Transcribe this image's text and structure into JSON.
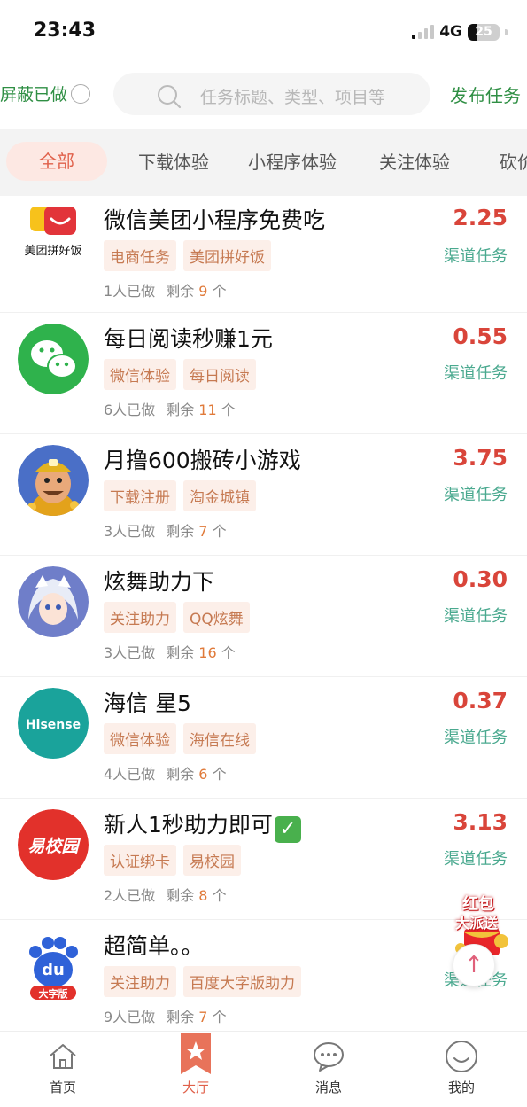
{
  "status_bar": {
    "time": "23:43",
    "network": "4G",
    "battery": "25",
    "battery_level": 0.25
  },
  "header": {
    "hide_done_label": "屏蔽已做",
    "search_placeholder": "任务标题、类型、项目等",
    "publish_label": "发布任务"
  },
  "tabs": [
    {
      "label": "全部",
      "active": true
    },
    {
      "label": "下载体验"
    },
    {
      "label": "小程序体验"
    },
    {
      "label": "关注体验"
    },
    {
      "label": "砍价"
    }
  ],
  "tasks": [
    {
      "title": "微信美团小程序免费吃",
      "tags": [
        "电商任务",
        "美团拼好饭"
      ],
      "done": "1人已做",
      "remain_label": "剩余",
      "remain_num": "9",
      "remain_unit": "个",
      "price": "2.25",
      "channel": "渠道任务",
      "logo_icon": "meituan-logo-icon",
      "logo_text": "美团拼好饭"
    },
    {
      "title": "每日阅读秒赚1元",
      "tags": [
        "微信体验",
        "每日阅读"
      ],
      "done": "6人已做",
      "remain_label": "剩余",
      "remain_num": "11",
      "remain_unit": "个",
      "price": "0.55",
      "channel": "渠道任务",
      "logo_icon": "wechat-logo-icon"
    },
    {
      "title": "月撸600搬砖小游戏",
      "tags": [
        "下载注册",
        "淘金城镇"
      ],
      "done": "3人已做",
      "remain_label": "剩余",
      "remain_num": "7",
      "remain_unit": "个",
      "price": "3.75",
      "channel": "渠道任务",
      "logo_icon": "miner-game-icon"
    },
    {
      "title": "炫舞助力下",
      "tags": [
        "关注助力",
        "QQ炫舞"
      ],
      "done": "3人已做",
      "remain_label": "剩余",
      "remain_num": "16",
      "remain_unit": "个",
      "price": "0.30",
      "channel": "渠道任务",
      "logo_icon": "qq-dance-icon"
    },
    {
      "title": "海信 星5",
      "tags": [
        "微信体验",
        "海信在线"
      ],
      "done": "4人已做",
      "remain_label": "剩余",
      "remain_num": "6",
      "remain_unit": "个",
      "price": "0.37",
      "channel": "渠道任务",
      "logo_icon": "hisense-logo-icon",
      "logo_text": "Hisense"
    },
    {
      "title": "新人1秒助力即可",
      "tags": [
        "认证绑卡",
        "易校园"
      ],
      "done": "2人已做",
      "remain_label": "剩余",
      "remain_num": "8",
      "remain_unit": "个",
      "price": "3.13",
      "channel": "渠道任务",
      "logo_icon": "yixiaoyuan-logo-icon",
      "logo_text": "易校园"
    },
    {
      "title": "超简单。。",
      "tags": [
        "关注助力",
        "百度大字版助力"
      ],
      "done": "9人已做",
      "remain_label": "剩余",
      "remain_num": "7",
      "remain_unit": "个",
      "price": "",
      "channel": "渠道任务",
      "logo_icon": "baidu-logo-icon",
      "logo_text": "du",
      "logo_subtext": "大字版"
    }
  ],
  "floater": {
    "line1": "红包",
    "line2": "大派送",
    "scroll_top_icon": "arrow-up-icon"
  },
  "bottom_nav": [
    {
      "label": "首页",
      "icon": "home-icon"
    },
    {
      "label": "大厅",
      "icon": "star-bookmark-icon",
      "active": true
    },
    {
      "label": "消息",
      "icon": "chat-bubble-icon"
    },
    {
      "label": "我的",
      "icon": "smile-face-icon"
    }
  ],
  "colors": {
    "green": "#2f8f44",
    "price_red": "#d9453a",
    "channel_teal": "#4aa98f",
    "tag_bg": "#fcefe9",
    "tag_text": "#c67a52",
    "accent": "#e0604a"
  }
}
